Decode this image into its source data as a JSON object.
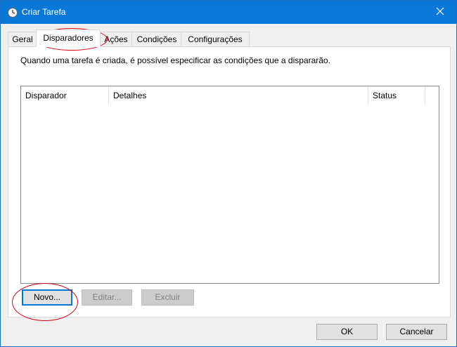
{
  "window": {
    "title": "Criar Tarefa"
  },
  "tabs": [
    {
      "label": "Geral"
    },
    {
      "label": "Disparadores"
    },
    {
      "label": "Ações"
    },
    {
      "label": "Condições"
    },
    {
      "label": "Configurações"
    }
  ],
  "active_tab": "Disparadores",
  "panel": {
    "description": "Quando uma tarefa é criada, é possível especificar as condições que a dispararão."
  },
  "triggers_table": {
    "columns": [
      {
        "label": "Disparador"
      },
      {
        "label": "Detalhes"
      },
      {
        "label": "Status"
      }
    ],
    "rows": []
  },
  "buttons": {
    "new": "Novo...",
    "edit": "Editar...",
    "delete": "Excluir",
    "ok": "OK",
    "cancel": "Cancelar"
  },
  "icons": {
    "title": "clock-icon",
    "close": "close-icon"
  },
  "colors": {
    "titlebar": "#0a78d7",
    "annotation": "#e3000f",
    "focus": "#0078d7"
  }
}
